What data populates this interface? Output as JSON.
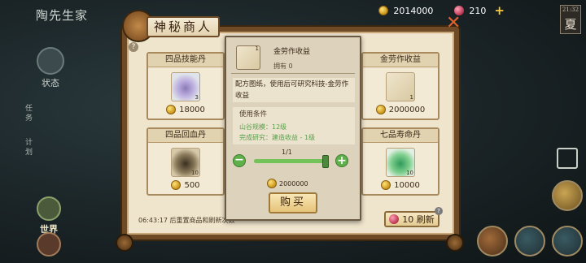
{
  "header": {
    "game_title": "陶先生家",
    "coins": "2014000",
    "gems": "210",
    "plus_symbol": "+",
    "season": {
      "label": "夏",
      "time": "21:32"
    }
  },
  "side_nav": {
    "status": "状态",
    "tasks": "任务",
    "plan": "计划",
    "world": "世界"
  },
  "shop": {
    "title": "神秘商人",
    "close_symbol": "✕",
    "help_symbol": "?",
    "items": [
      {
        "name": "四品技能丹",
        "qty": "3",
        "price": "18000",
        "icon": "skill-pill-icon"
      },
      {
        "name": "四品回血丹",
        "qty": "10",
        "price": "500",
        "icon": "heal-pill-icon"
      },
      {
        "name": "金劳作收益",
        "qty": "1",
        "price": "2000000",
        "icon": "recipe-scroll-icon"
      },
      {
        "name": "七品寿命丹",
        "qty": "10",
        "price": "10000",
        "icon": "longevity-pill-icon"
      }
    ],
    "refresh_note": "06:43:17 后重置商品和刷新次数",
    "refresh_label": "10 刷新",
    "refresh_badge": "?"
  },
  "detail": {
    "name": "金劳作收益",
    "icon_qty": "1",
    "owned": "拥有 0",
    "description": "配方图纸，使用后可研究科技-金劳作收益",
    "conditions_title": "使用条件",
    "conditions": [
      "山谷规模：12级",
      "完成研究：建造收益 - 1级"
    ],
    "quantity": "1/1",
    "quantity_fraction": 1.0,
    "minus_symbol": "−",
    "plus_symbol": "+",
    "price": "2000000",
    "buy_label": "购买"
  },
  "colors": {
    "accent_green": "#5fb04a",
    "frame_brown": "#6e4a26",
    "close_orange": "#e0632c"
  }
}
